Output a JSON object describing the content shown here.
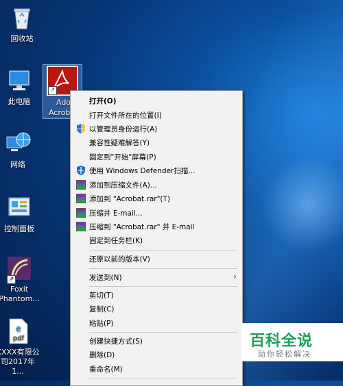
{
  "desktop": {
    "icons": [
      {
        "label": "回收站"
      },
      {
        "label": "此电脑"
      },
      {
        "label": "网络"
      },
      {
        "label": "控制面板"
      },
      {
        "label_line1": "Foxit",
        "label_line2": "Phantom..."
      },
      {
        "label_line1": "XXXX有限公",
        "label_line2": "司2017年1..."
      }
    ],
    "selected_icon": {
      "label_line1": "Adob",
      "label_line2": "Acroba"
    }
  },
  "context_menu": {
    "items": [
      {
        "label": "打开(O)",
        "bold": true
      },
      {
        "label": "打开文件所在的位置(I)"
      },
      {
        "label": "以管理员身份运行(A)",
        "icon": "uac-shield-icon"
      },
      {
        "label": "兼容性疑难解答(Y)"
      },
      {
        "label": "固定到\"开始\"屏幕(P)"
      },
      {
        "label": "使用 Windows Defender扫描...",
        "icon": "defender-icon"
      },
      {
        "label": "添加到压缩文件(A)...",
        "icon": "winrar-icon"
      },
      {
        "label": "添加到 \"Acrobat.rar\"(T)",
        "icon": "winrar-icon"
      },
      {
        "label": "压缩并 E-mail...",
        "icon": "winrar-icon"
      },
      {
        "label": "压缩到 \"Acrobat.rar\" 并 E-mail",
        "icon": "winrar-icon"
      },
      {
        "label": "固定到任务栏(K)"
      },
      {
        "label": "还原以前的版本(V)"
      },
      {
        "label": "发送到(N)",
        "submenu": true
      },
      {
        "label": "剪切(T)"
      },
      {
        "label": "复制(C)"
      },
      {
        "label": "粘贴(P)"
      },
      {
        "label": "创建快捷方式(S)"
      },
      {
        "label": "删除(D)"
      },
      {
        "label": "重命名(M)"
      }
    ]
  },
  "watermark": {
    "title": "百科全说",
    "subtitle": "助你轻松解决"
  }
}
